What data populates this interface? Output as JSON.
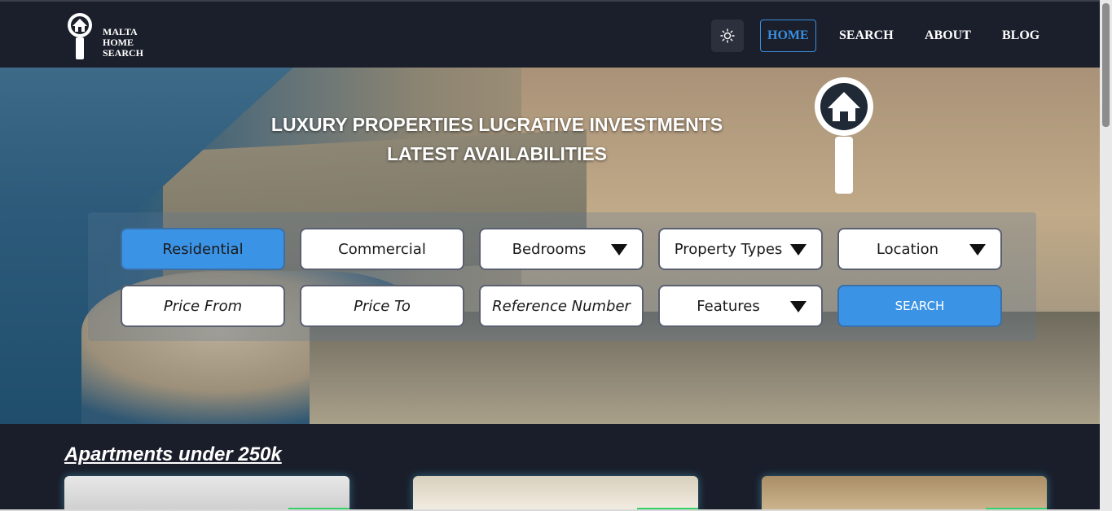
{
  "header": {
    "logo_text_line1": "MALTA",
    "logo_text_line2": "HOME",
    "logo_text_line3": "SEARCH",
    "theme_toggle_icon": "sun-icon",
    "nav": [
      {
        "label": "HOME",
        "active": true
      },
      {
        "label": "SEARCH",
        "active": false
      },
      {
        "label": "ABOUT",
        "active": false
      },
      {
        "label": "BLOG",
        "active": false
      }
    ]
  },
  "hero": {
    "title_line1": "LUXURY PROPERTIES LUCRATIVE INVESTMENTS",
    "title_line2": "LATEST AVAILABILITIES"
  },
  "search": {
    "residential": "Residential",
    "commercial": "Commercial",
    "bedrooms": "Bedrooms",
    "property_types": "Property Types",
    "location": "Location",
    "price_from": "Price From",
    "price_to": "Price To",
    "reference_number": "Reference Number",
    "features": "Features",
    "search_button": "SEARCH"
  },
  "section": {
    "title": "Apartments under 250k"
  },
  "colors": {
    "accent": "#3b93e6",
    "background": "#1b1f2b",
    "card_glow": "#50c8e6",
    "tag": "#35d06a"
  }
}
